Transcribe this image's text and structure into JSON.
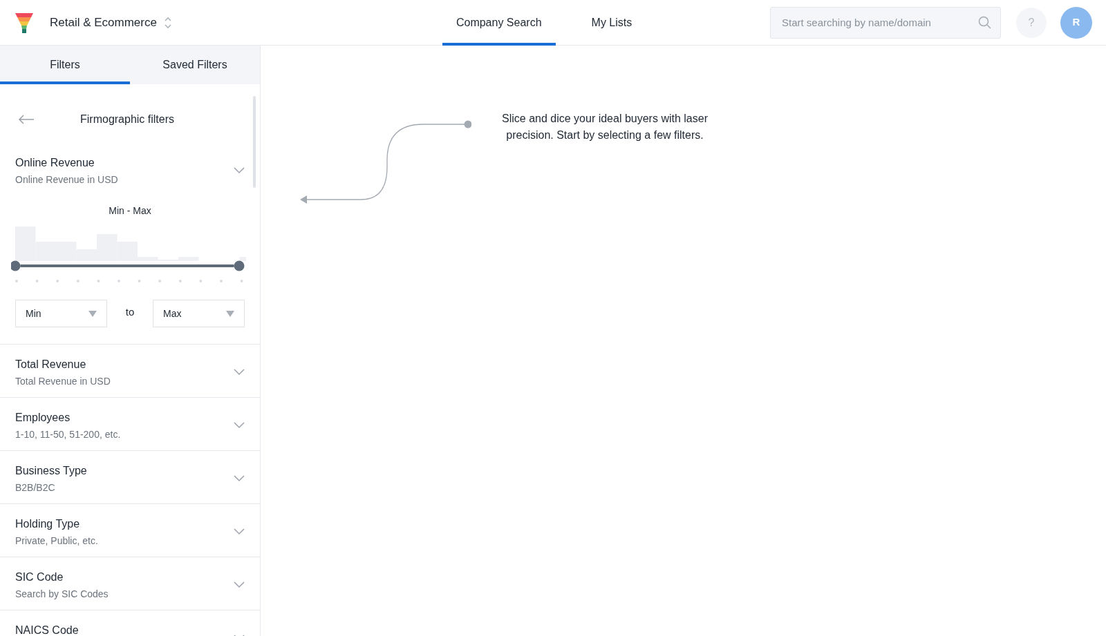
{
  "header": {
    "workspace": "Retail & Ecommerce",
    "nav": [
      {
        "label": "Company Search",
        "selected": true
      },
      {
        "label": "My Lists",
        "selected": false
      }
    ],
    "search": {
      "placeholder": "Start searching by name/domain"
    },
    "help": "?",
    "avatar": "R"
  },
  "sidebar": {
    "tabs": [
      {
        "label": "Filters",
        "selected": true
      },
      {
        "label": "Saved Filters",
        "selected": false
      }
    ],
    "section_title": "Firmographic filters",
    "expanded_filter": {
      "title": "Online Revenue",
      "subtitle": "Online Revenue in USD",
      "range_label": "Min - Max",
      "slider_min": {
        "level": 0
      },
      "slider_max": {
        "level": 1
      },
      "min_select": "Min",
      "to": "to",
      "max_select": "Max"
    },
    "filters": [
      {
        "title": "Total Revenue",
        "subtitle": "Total Revenue in USD"
      },
      {
        "title": "Employees",
        "subtitle": "1-10, 11-50, 51-200, etc."
      },
      {
        "title": "Business Type",
        "subtitle": "B2B/B2C"
      },
      {
        "title": "Holding Type",
        "subtitle": "Private, Public, etc."
      },
      {
        "title": "SIC Code",
        "subtitle": "Search by SIC Codes"
      },
      {
        "title": "NAICS Code"
      }
    ]
  },
  "hint": "Slice and dice your ideal buyers with laser precision. Start by selecting a few filters."
}
